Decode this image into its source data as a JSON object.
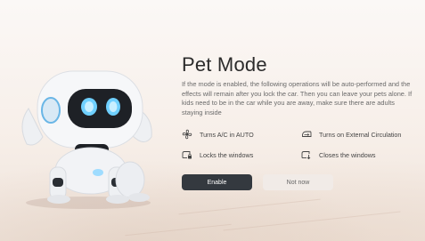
{
  "dialog": {
    "title": "Pet Mode",
    "description": "If the mode is enabled, the following operations will be auto-performed and the effects will remain after you lock the car. Then you can leave your pets alone. If kids need to be in the car while you are away, make sure there are adults staying inside"
  },
  "features": [
    {
      "label": "Turns A/C in AUTO",
      "icon": "fan-icon"
    },
    {
      "label": "Turns on External Circulation",
      "icon": "air-circulation-icon"
    },
    {
      "label": "Locks the windows",
      "icon": "window-lock-icon"
    },
    {
      "label": "Closes the windows",
      "icon": "window-close-icon"
    }
  ],
  "buttons": {
    "enable": "Enable",
    "not_now": "Not now"
  },
  "colors": {
    "primary_button": "#34393f",
    "secondary_button": "#f1ebe7",
    "robot_eye": "#5ec8ff",
    "background": "#f7efe9"
  }
}
